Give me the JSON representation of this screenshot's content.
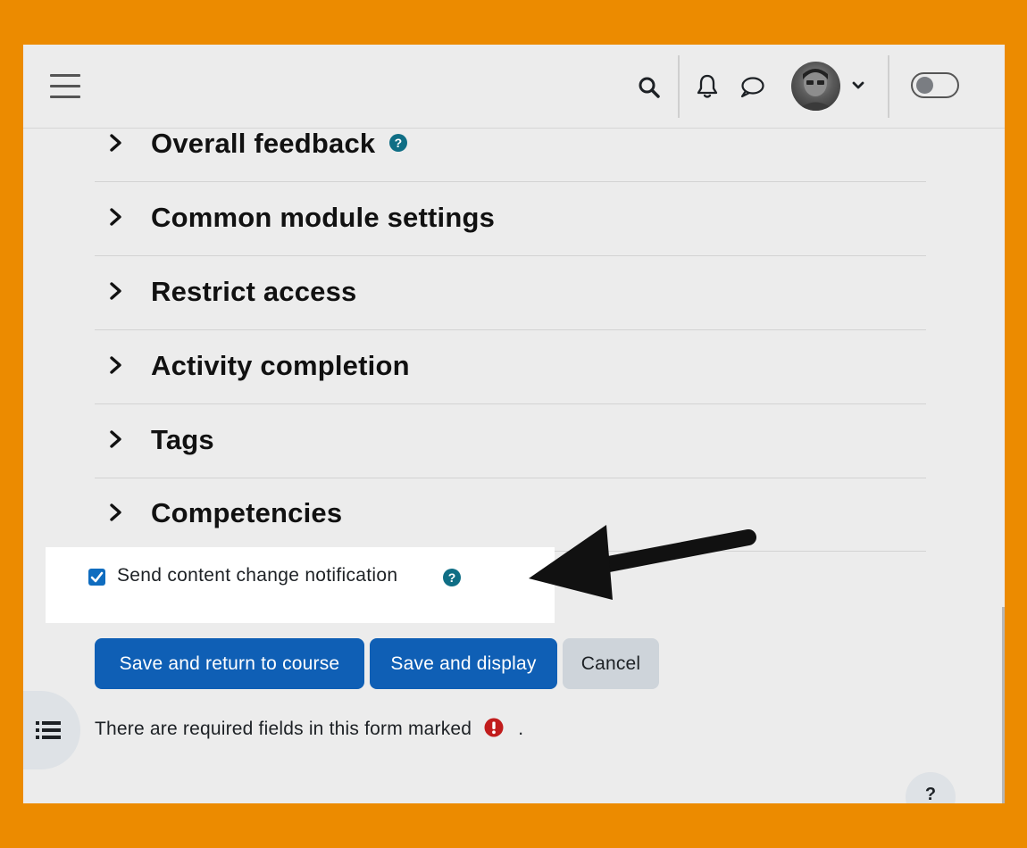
{
  "navbar": {
    "icons": [
      "hamburger-menu-icon",
      "search-icon",
      "bell-icon",
      "chat-bubble-icon",
      "avatar",
      "chevron-down-icon",
      "dark-mode-toggle"
    ]
  },
  "sections": [
    {
      "title": "Overall feedback",
      "has_help": true
    },
    {
      "title": "Common module settings",
      "has_help": false
    },
    {
      "title": "Restrict access",
      "has_help": false
    },
    {
      "title": "Activity completion",
      "has_help": false
    },
    {
      "title": "Tags",
      "has_help": false
    },
    {
      "title": "Competencies",
      "has_help": false
    }
  ],
  "notification": {
    "label": "Send content change notification",
    "checked": true
  },
  "buttons": {
    "save_return": "Save and return to course",
    "save_display": "Save and display",
    "cancel": "Cancel"
  },
  "required_note": {
    "text": "There are required fields in this form marked",
    "suffix": "."
  },
  "help_float": {
    "label": "?"
  },
  "colors": {
    "primary": "#0f5fb5",
    "help": "#0f6e85",
    "required": "#c11c1c",
    "frame_border": "#ec8b00"
  }
}
